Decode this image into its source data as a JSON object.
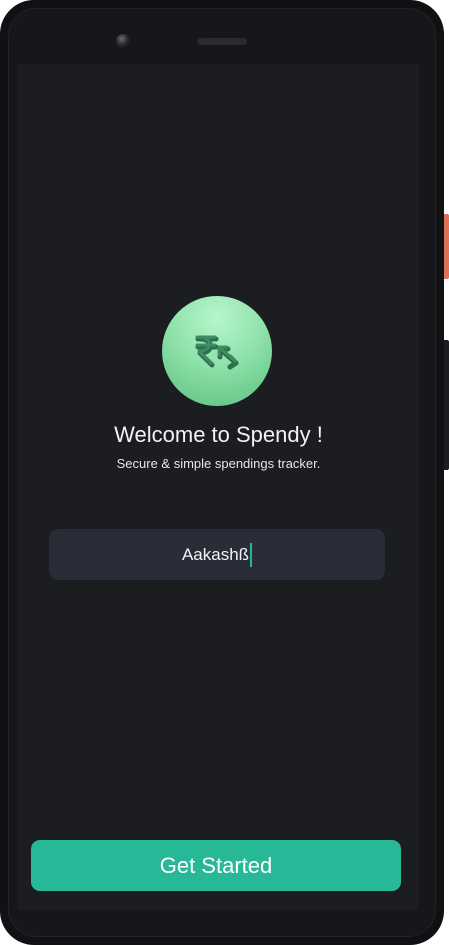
{
  "app": {
    "logo_icon": "rupee-arrow-icon",
    "brand_color": "#27b997",
    "logo_gradient": [
      "#b8f5cc",
      "#5cc07f"
    ]
  },
  "welcome": {
    "title": "Welcome to Spendy !",
    "subtitle": "Secure & simple spendings tracker."
  },
  "name_input": {
    "value": "Aakashß"
  },
  "actions": {
    "get_started_label": "Get Started"
  }
}
